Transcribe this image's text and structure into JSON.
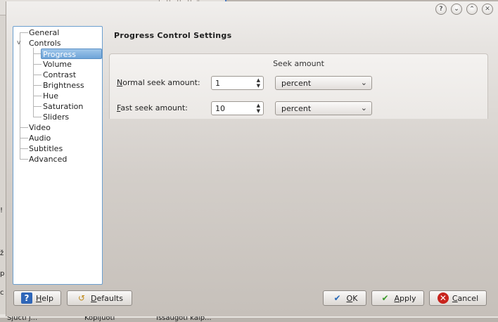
{
  "dialog": {
    "title_buttons": {
      "help": "?",
      "minimize": "⌄",
      "maximize": "⌃",
      "close": "✕"
    }
  },
  "background": {
    "fragments_left": [
      "!",
      "ž",
      "p",
      "c"
    ],
    "bottom_texts": [
      "Sjučti j...",
      "Kopijuoti",
      "Išsaugoti kaip..."
    ]
  },
  "sidebar": {
    "items": [
      {
        "label": "General",
        "level": 0,
        "expander": ""
      },
      {
        "label": "Controls",
        "level": 0,
        "expander": "v"
      },
      {
        "label": "Progress",
        "level": 1,
        "selected": true
      },
      {
        "label": "Volume",
        "level": 1
      },
      {
        "label": "Contrast",
        "level": 1
      },
      {
        "label": "Brightness",
        "level": 1
      },
      {
        "label": "Hue",
        "level": 1
      },
      {
        "label": "Saturation",
        "level": 1
      },
      {
        "label": "Sliders",
        "level": 1
      },
      {
        "label": "Video",
        "level": 0
      },
      {
        "label": "Audio",
        "level": 0
      },
      {
        "label": "Subtitles",
        "level": 0
      },
      {
        "label": "Advanced",
        "level": 0
      }
    ]
  },
  "page": {
    "title": "Progress Control Settings",
    "group_title": "Seek amount",
    "normal_seek": {
      "label_first": "N",
      "label_rest": "ormal seek amount:",
      "value": "1",
      "unit": "percent"
    },
    "fast_seek": {
      "label_first": "F",
      "label_rest": "ast seek amount:",
      "value": "10",
      "unit": "percent"
    }
  },
  "buttons": {
    "help": {
      "first": "H",
      "rest": "elp"
    },
    "defaults": {
      "first": "D",
      "rest": "efaults"
    },
    "ok": {
      "first": "O",
      "rest": "K"
    },
    "apply": {
      "first": "A",
      "rest": "pply"
    },
    "cancel": {
      "first": "C",
      "rest": "ancel"
    }
  },
  "icons": {
    "help": "help-book-icon",
    "defaults": "defaults-reset-icon",
    "ok": "checkmark-icon",
    "apply": "checkmark-green-icon",
    "cancel": "cancel-circle-icon"
  },
  "colors": {
    "selection": "#6ea4d8",
    "tree_border": "#6c9fcf",
    "cancel": "#c8241d",
    "apply": "#3a9a2a"
  }
}
